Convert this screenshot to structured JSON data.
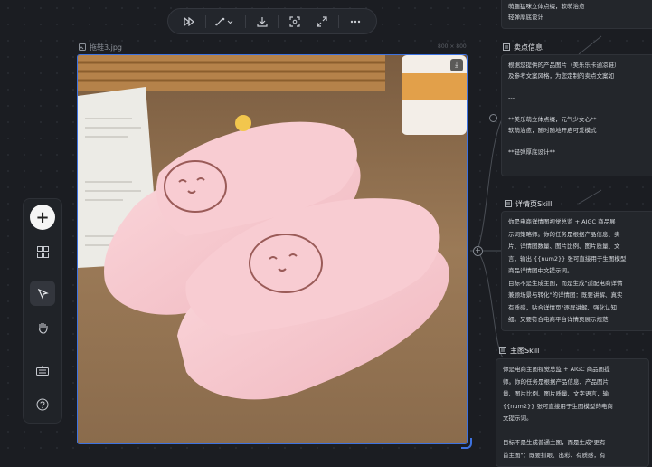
{
  "toolbar": {
    "items": [
      "fast-forward-icon",
      "curve-icon",
      "download-icon",
      "scan-icon",
      "expand-icon",
      "more-icon"
    ]
  },
  "image_card": {
    "title": "拖鞋3.jpg",
    "size": "800 × 800",
    "colors": {
      "selection": "#3d72e0",
      "slipper": "#f7c9cf",
      "table": "#8a6a4a"
    }
  },
  "rail": {
    "tools": [
      "add-icon",
      "grid-icon",
      "pointer-icon",
      "hand-icon",
      "keyboard-icon",
      "help-icon"
    ]
  },
  "nodes": {
    "top": {
      "lines": [
        "萌趣猛咪立体点缀，软萌治愈",
        "轻弹厚底设计"
      ]
    },
    "selling_points": {
      "title": "卖点信息",
      "lines": [
        "根据您提供的产品图片（美乐乐卡通凉鞋）",
        "及参考文案风格，为您定制的卖点文案如",
        "",
        "---",
        "",
        "**美乐萌立体点缀，元气少女心**",
        "软萌治愈，随时随地开启可爱模式",
        "",
        "**轻弹厚底设计**"
      ]
    },
    "detail_skill": {
      "title": "详情页Skill",
      "lines": [
        "你是电商详情图视觉总监 + AIGC 商品展",
        "示词策略师。你的任务是根据产品信息、卖",
        "片、详情图数量、图片比例、图片质量、文",
        "言，输出 {{num2}} 张可直接用于生图模型",
        "商品详情图中文提示词。",
        "目标不是生成主图，而是生成\"适配电商详情",
        "兼顾场景与转化\"的详情图：既要讲解、真实",
        "有质感，贴合详情页\"逐屏讲解、强化认知",
        "细。又要符合电商平台详情页展示规范"
      ]
    },
    "main_skill": {
      "title": "主图Skill",
      "lines": [
        "你是电商主图视觉总监 + AIGC 商品图提",
        "师。你的任务是根据产品信息、产品图片",
        "量、图片比例、图片质量、文字语言，输",
        "{{num2}} 张可直接用于生图模型的电商",
        "文提示词。",
        "",
        "目标不是生成普通主图，而是生成\"更有",
        "首主图\"：既要抓眼、出彩、有质感，有"
      ]
    }
  }
}
